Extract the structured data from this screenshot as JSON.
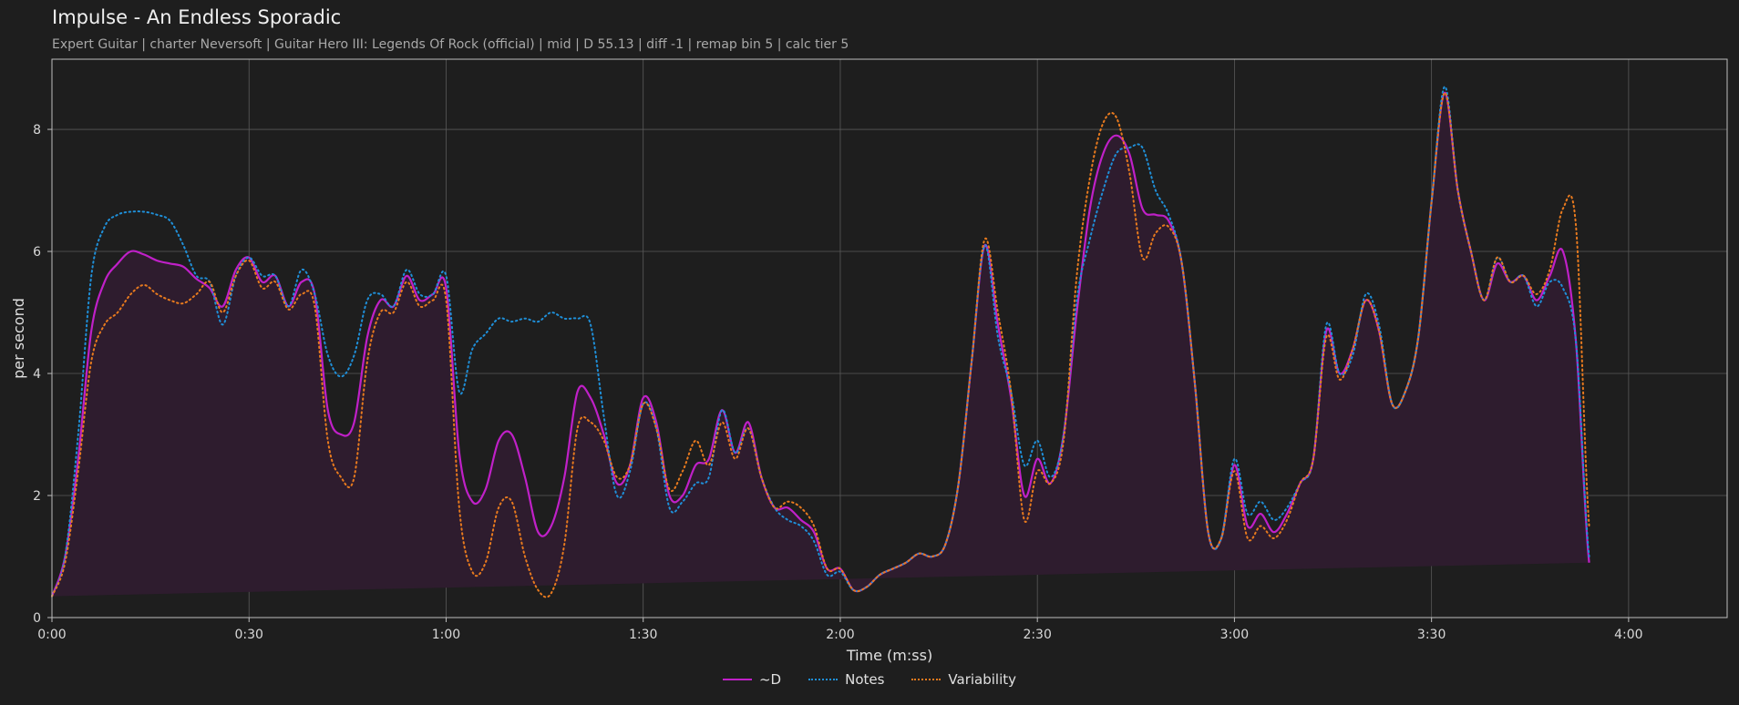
{
  "header": {
    "title": "Impulse - An Endless Sporadic",
    "subtitle": "Expert Guitar  |  charter Neversoft  |  Guitar Hero III: Legends Of Rock (official)  |  mid  |  D 55.13  |  diff -1  |  remap bin 5  |  calc tier 5"
  },
  "colors": {
    "background": "#1e1e1e",
    "d_series": "#c020c8",
    "notes_series": "#1f8fd8",
    "variability_series": "#e87a1e",
    "area_fill": "#2e1c2e",
    "grid": "#5a5a5a"
  },
  "chart_data": {
    "type": "line",
    "title": "Impulse - An Endless Sporadic",
    "xlabel": "Time (m:ss)",
    "ylabel": "per second",
    "xlim": [
      0,
      255
    ],
    "ylim": [
      0,
      9.15
    ],
    "grid": true,
    "legend_position": "bottom-center",
    "x_ticks": [
      {
        "value": 0,
        "label": "0:00"
      },
      {
        "value": 30,
        "label": "0:30"
      },
      {
        "value": 60,
        "label": "1:00"
      },
      {
        "value": 90,
        "label": "1:30"
      },
      {
        "value": 120,
        "label": "2:00"
      },
      {
        "value": 150,
        "label": "2:30"
      },
      {
        "value": 180,
        "label": "3:00"
      },
      {
        "value": 210,
        "label": "3:30"
      },
      {
        "value": 240,
        "label": "4:00"
      }
    ],
    "y_ticks": [
      {
        "value": 0,
        "label": "0"
      },
      {
        "value": 2,
        "label": "2"
      },
      {
        "value": 4,
        "label": "4"
      },
      {
        "value": 6,
        "label": "6"
      },
      {
        "value": 8,
        "label": "8"
      }
    ],
    "x": [
      0,
      2,
      4,
      6,
      8,
      10,
      12,
      14,
      16,
      18,
      20,
      22,
      24,
      26,
      28,
      30,
      32,
      34,
      36,
      38,
      40,
      42,
      44,
      46,
      48,
      50,
      52,
      54,
      56,
      58,
      60,
      62,
      64,
      66,
      68,
      70,
      72,
      74,
      76,
      78,
      80,
      82,
      84,
      86,
      88,
      90,
      92,
      94,
      96,
      98,
      100,
      102,
      104,
      106,
      108,
      110,
      112,
      114,
      116,
      118,
      120,
      122,
      124,
      126,
      128,
      130,
      132,
      134,
      136,
      138,
      140,
      142,
      144,
      146,
      148,
      150,
      152,
      154,
      156,
      158,
      160,
      162,
      164,
      166,
      168,
      170,
      172,
      174,
      176,
      178,
      180,
      182,
      184,
      186,
      188,
      190,
      192,
      194,
      196,
      198,
      200,
      202,
      204,
      206,
      208,
      210,
      212,
      214,
      216,
      218,
      220,
      222,
      224,
      226,
      228,
      230,
      232,
      234,
      236,
      238,
      240,
      242,
      244,
      246,
      248,
      250,
      252,
      254,
      255
    ],
    "series": [
      {
        "name": "~D",
        "style": "solid",
        "values": [
          0.35,
          1.0,
          2.6,
          4.7,
          5.5,
          5.8,
          6.0,
          5.95,
          5.85,
          5.8,
          5.75,
          5.55,
          5.4,
          5.1,
          5.7,
          5.9,
          5.5,
          5.6,
          5.1,
          5.5,
          5.3,
          3.4,
          3.0,
          3.2,
          4.6,
          5.2,
          5.1,
          5.6,
          5.2,
          5.3,
          5.4,
          2.7,
          1.9,
          2.1,
          2.9,
          3.0,
          2.3,
          1.4,
          1.5,
          2.3,
          3.7,
          3.6,
          3.0,
          2.2,
          2.5,
          3.6,
          3.2,
          2.0,
          2.0,
          2.5,
          2.6,
          3.4,
          2.7,
          3.2,
          2.3,
          1.8,
          1.8,
          1.6,
          1.4,
          0.8,
          0.8,
          0.45,
          0.5,
          0.7,
          0.8,
          0.9,
          1.05,
          1.0,
          1.2,
          2.2,
          4.2,
          6.1,
          4.8,
          3.6,
          2.0,
          2.6,
          2.2,
          3.0,
          5.0,
          6.7,
          7.6,
          7.9,
          7.6,
          6.7,
          6.6,
          6.5,
          5.8,
          3.8,
          1.4,
          1.3,
          2.5,
          1.5,
          1.7,
          1.4,
          1.7,
          2.2,
          2.6,
          4.7,
          4.0,
          4.4,
          5.2,
          4.7,
          3.5,
          3.7,
          4.6,
          6.8,
          8.6,
          7.0,
          6.0,
          5.2,
          5.8,
          5.5,
          5.6,
          5.2,
          5.6,
          6.0,
          4.5,
          0.9,
          0.8
        ]
      },
      {
        "name": "Notes",
        "style": "dotted",
        "values": [
          0.35,
          1.0,
          3.0,
          5.6,
          6.4,
          6.6,
          6.65,
          6.65,
          6.6,
          6.5,
          6.1,
          5.6,
          5.5,
          4.8,
          5.6,
          5.9,
          5.6,
          5.6,
          5.1,
          5.7,
          5.3,
          4.3,
          3.95,
          4.3,
          5.2,
          5.3,
          5.1,
          5.7,
          5.3,
          5.3,
          5.6,
          3.7,
          4.4,
          4.65,
          4.9,
          4.85,
          4.9,
          4.85,
          5.0,
          4.9,
          4.9,
          4.8,
          3.3,
          2.0,
          2.4,
          3.5,
          3.1,
          1.8,
          1.9,
          2.2,
          2.3,
          3.4,
          2.7,
          3.1,
          2.3,
          1.8,
          1.6,
          1.5,
          1.25,
          0.7,
          0.75,
          0.45,
          0.5,
          0.7,
          0.8,
          0.9,
          1.05,
          1.0,
          1.2,
          2.2,
          4.2,
          6.1,
          4.6,
          3.7,
          2.5,
          2.9,
          2.3,
          3.0,
          5.2,
          6.2,
          7.0,
          7.6,
          7.7,
          7.7,
          7.0,
          6.6,
          5.8,
          3.8,
          1.4,
          1.3,
          2.6,
          1.7,
          1.9,
          1.6,
          1.8,
          2.2,
          2.6,
          4.8,
          4.0,
          4.3,
          5.3,
          4.8,
          3.5,
          3.7,
          4.6,
          6.8,
          8.7,
          7.0,
          6.0,
          5.2,
          5.9,
          5.5,
          5.6,
          5.1,
          5.5,
          5.4,
          4.5,
          1.0,
          0.8
        ]
      },
      {
        "name": "Variability",
        "style": "dotted",
        "values": [
          0.35,
          0.9,
          2.4,
          4.2,
          4.8,
          5.0,
          5.3,
          5.45,
          5.3,
          5.2,
          5.15,
          5.3,
          5.5,
          5.0,
          5.6,
          5.85,
          5.4,
          5.5,
          5.05,
          5.3,
          5.1,
          2.9,
          2.3,
          2.3,
          4.2,
          5.0,
          5.0,
          5.5,
          5.1,
          5.2,
          5.2,
          1.8,
          0.75,
          0.9,
          1.8,
          1.9,
          1.0,
          0.45,
          0.4,
          1.2,
          3.1,
          3.2,
          2.9,
          2.3,
          2.5,
          3.5,
          3.1,
          2.1,
          2.4,
          2.9,
          2.5,
          3.2,
          2.6,
          3.1,
          2.3,
          1.8,
          1.9,
          1.8,
          1.5,
          0.8,
          0.8,
          0.45,
          0.5,
          0.7,
          0.8,
          0.9,
          1.05,
          1.0,
          1.2,
          2.2,
          4.2,
          6.2,
          5.0,
          3.7,
          1.6,
          2.4,
          2.2,
          2.9,
          5.6,
          7.2,
          8.1,
          8.2,
          7.3,
          5.9,
          6.3,
          6.4,
          5.8,
          3.8,
          1.4,
          1.3,
          2.4,
          1.3,
          1.5,
          1.3,
          1.6,
          2.2,
          2.6,
          4.6,
          3.9,
          4.4,
          5.2,
          4.7,
          3.5,
          3.7,
          4.6,
          6.8,
          8.6,
          7.0,
          6.0,
          5.2,
          5.9,
          5.5,
          5.6,
          5.3,
          5.7,
          6.7,
          6.4,
          1.5,
          1.0
        ]
      }
    ]
  }
}
